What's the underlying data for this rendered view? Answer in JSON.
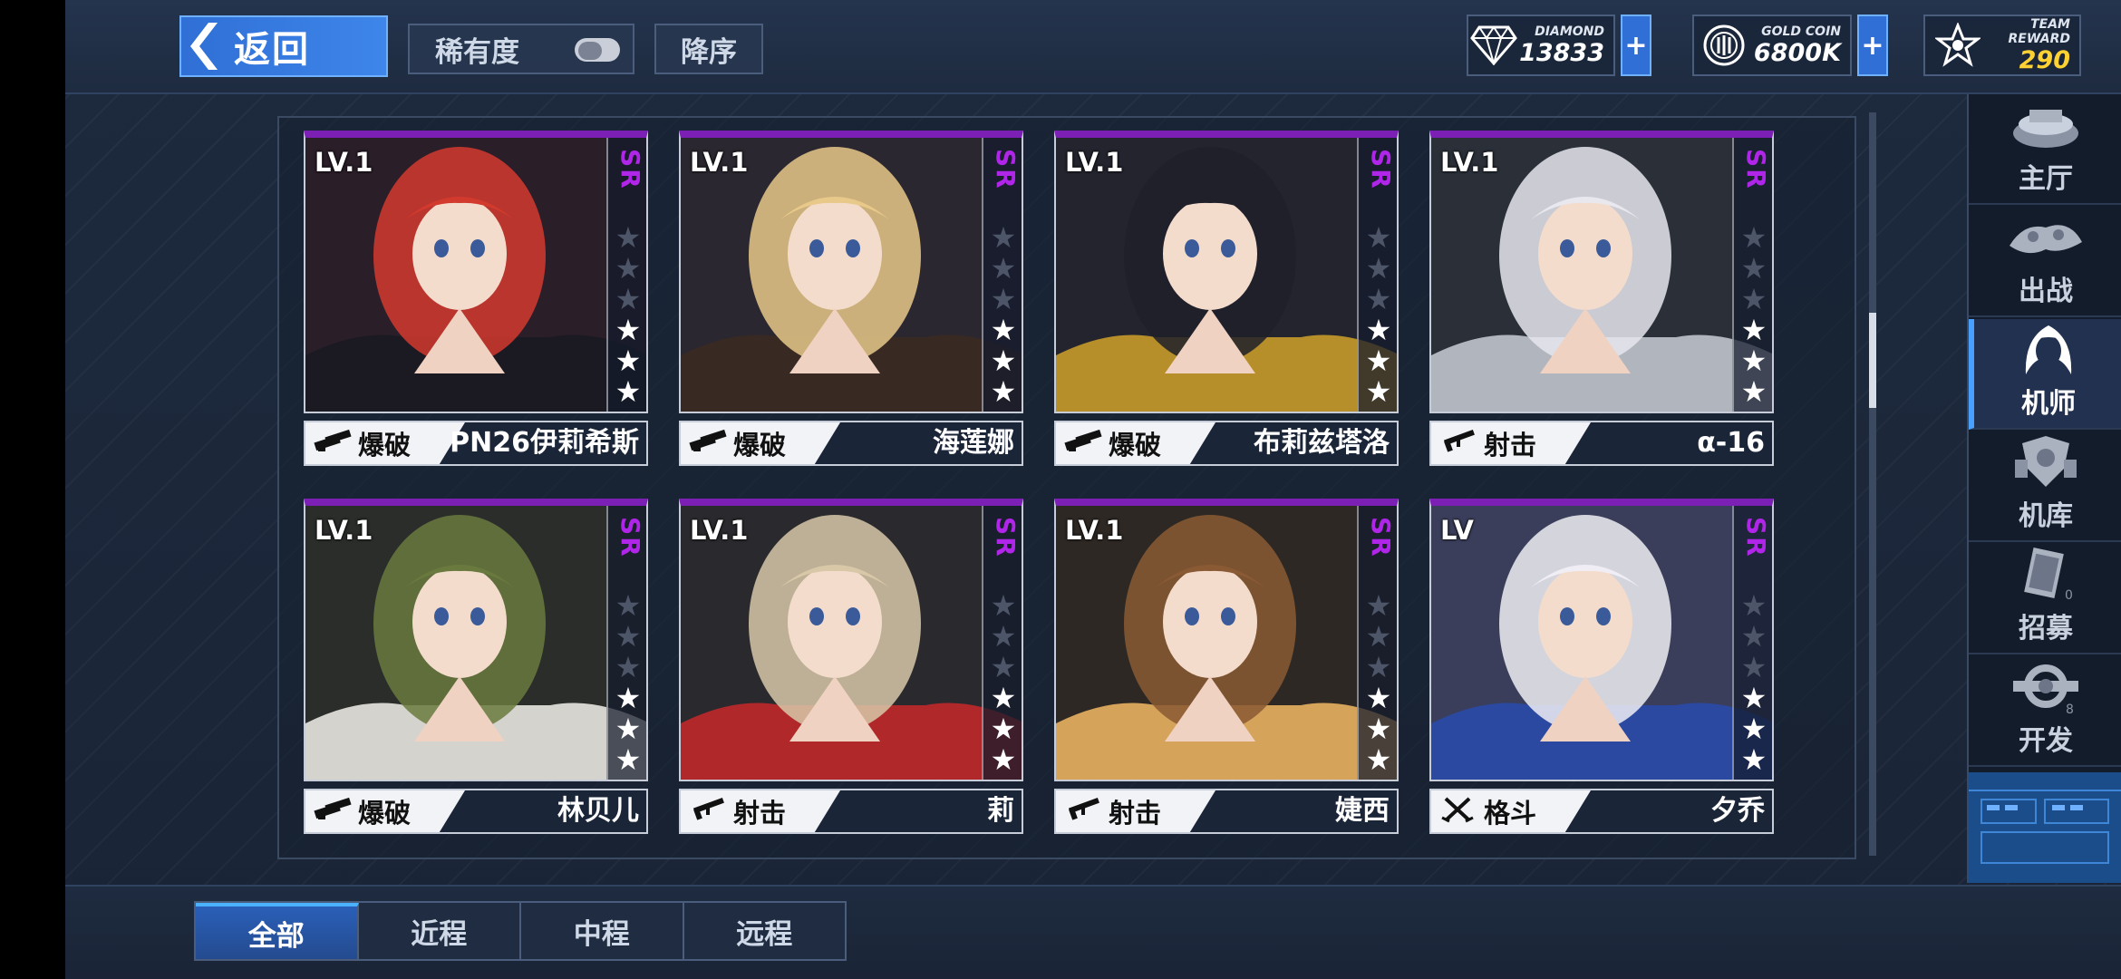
{
  "header": {
    "back_label": "返回",
    "sort_rarity_label": "稀有度",
    "sort_order_label": "降序"
  },
  "resources": {
    "diamond": {
      "label": "DIAMOND",
      "value": "13833",
      "icon": "diamond-icon"
    },
    "gold": {
      "label": "GOLD COIN",
      "value": "6800K",
      "icon": "gold-coin-icon"
    },
    "team": {
      "label": "TEAM REWARD",
      "value": "290",
      "icon": "team-reward-star-icon"
    },
    "plus_label": "+"
  },
  "cards": [
    {
      "level": "LV.1",
      "rarity": "SR",
      "stars_total": 6,
      "stars_filled": 3,
      "type": "爆破",
      "type_icon": "demolition-icon",
      "name": "PN26伊莉希斯",
      "palette": [
        "#2a1e28",
        "#d23a2e",
        "#1a1a22"
      ]
    },
    {
      "level": "LV.1",
      "rarity": "SR",
      "stars_total": 6,
      "stars_filled": 3,
      "type": "爆破",
      "type_icon": "demolition-icon",
      "name": "海莲娜",
      "palette": [
        "#2b2730",
        "#e8c98a",
        "#3a2a22"
      ]
    },
    {
      "level": "LV.1",
      "rarity": "SR",
      "stars_total": 6,
      "stars_filled": 3,
      "type": "爆破",
      "type_icon": "demolition-icon",
      "name": "布莉兹塔洛",
      "palette": [
        "#23242e",
        "#20202a",
        "#c79a2a"
      ]
    },
    {
      "level": "LV.1",
      "rarity": "SR",
      "stars_total": 6,
      "stars_filled": 3,
      "type": "射击",
      "type_icon": "rifle-icon",
      "name": "α-16",
      "palette": [
        "#2a2f38",
        "#e8e8ee",
        "#c0c4cc"
      ]
    },
    {
      "level": "LV.1",
      "rarity": "SR",
      "stars_total": 6,
      "stars_filled": 3,
      "type": "爆破",
      "type_icon": "demolition-icon",
      "name": "林贝儿",
      "palette": [
        "#2a2d2a",
        "#6a7a3e",
        "#e8e6e0"
      ]
    },
    {
      "level": "LV.1",
      "rarity": "SR",
      "stars_total": 6,
      "stars_filled": 3,
      "type": "射击",
      "type_icon": "rifle-icon",
      "name": "莉",
      "palette": [
        "#2a2a2e",
        "#d8c8a8",
        "#c0282a"
      ]
    },
    {
      "level": "LV.1",
      "rarity": "SR",
      "stars_total": 6,
      "stars_filled": 3,
      "type": "射击",
      "type_icon": "rifle-icon",
      "name": "婕西",
      "palette": [
        "#2e2824",
        "#8a5a34",
        "#e8b060"
      ]
    },
    {
      "level": "LV",
      "rarity": "SR",
      "stars_total": 6,
      "stars_filled": 3,
      "type": "格斗",
      "type_icon": "melee-swords-icon",
      "name": "夕乔",
      "palette": [
        "#3a3e5a",
        "#f0eef4",
        "#2a4aa8"
      ]
    }
  ],
  "sidenav": [
    {
      "label": "主厅",
      "icon": "hall-icon",
      "active": false
    },
    {
      "label": "出战",
      "icon": "battle-icon",
      "active": false
    },
    {
      "label": "机师",
      "icon": "pilot-icon",
      "active": true
    },
    {
      "label": "机库",
      "icon": "hangar-icon",
      "active": false
    },
    {
      "label": "招募",
      "icon": "recruit-card-icon",
      "active": false
    },
    {
      "label": "开发",
      "icon": "develop-wrench-icon",
      "active": false
    }
  ],
  "tabs": [
    {
      "label": "全部",
      "active": true
    },
    {
      "label": "近程",
      "active": false
    },
    {
      "label": "中程",
      "active": false
    },
    {
      "label": "远程",
      "active": false
    }
  ],
  "colors": {
    "accent_blue": "#3e86ea",
    "rarity_sr": "#b026e8",
    "card_top_bar": "#7c1fb4",
    "team_reward_value": "#ffd233"
  }
}
